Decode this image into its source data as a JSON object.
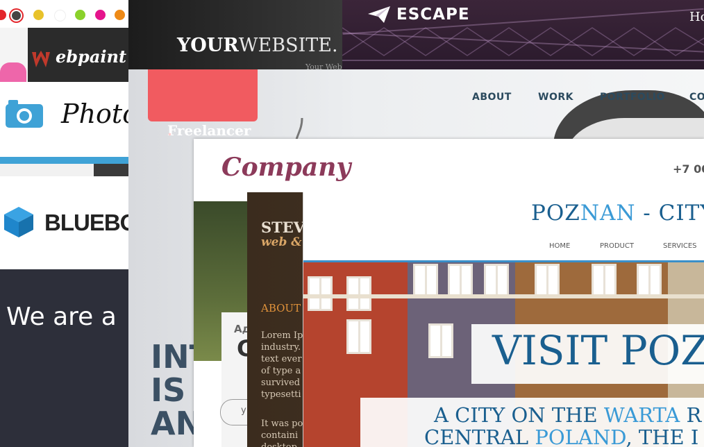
{
  "paint": {
    "brand": "ebpaint",
    "swatches": [
      "#e3262b",
      "#444444",
      "#e8c22a",
      "#ffffff",
      "#8ad12b",
      "#e5148c",
      "#ee8a17"
    ]
  },
  "photo": {
    "title": "Photo"
  },
  "bluebox": {
    "brand": "BLUEBOX"
  },
  "weare": {
    "text": "We are a"
  },
  "yourwebsite": {
    "bold": "YOUR",
    "light": "WEBSITE.",
    "tagline": "Your Web"
  },
  "escape": {
    "brand": "ESCAPE",
    "nav_fragment": "Ho"
  },
  "freelancer": {
    "brand_main": "Freelancer",
    "brand_dot": ".",
    "nav": [
      "ABOUT",
      "WORK",
      "PORTFOLIO",
      "CO"
    ],
    "hero": [
      "INT",
      "IS",
      "AN"
    ]
  },
  "company": {
    "brand": "Company",
    "phone": "+7 00",
    "ru_label": "Ад",
    "big_letter": "C",
    "input_placeholder": "у"
  },
  "steve": {
    "name": "STEV",
    "subtitle": "web &",
    "about": "ABOUT",
    "lorem": [
      "Lorem Ip",
      "industry.",
      "text ever",
      "of type a",
      "survived",
      "typesetti"
    ],
    "lorem2": [
      "It was po",
      "containi",
      "desktop"
    ]
  },
  "poznan": {
    "title_a": "POZ",
    "title_b": "NAN",
    "title_c": " - CITY",
    "nav": [
      "HOME",
      "PRODUCT",
      "SERVICES"
    ],
    "visit": "VISIT POZ",
    "line1_a": "A CITY ON THE ",
    "line1_b": "WARTA",
    "line1_c": " R",
    "line2_a": "CENTRAL ",
    "line2_b": "POLAND",
    "line2_c": ", THE I"
  }
}
